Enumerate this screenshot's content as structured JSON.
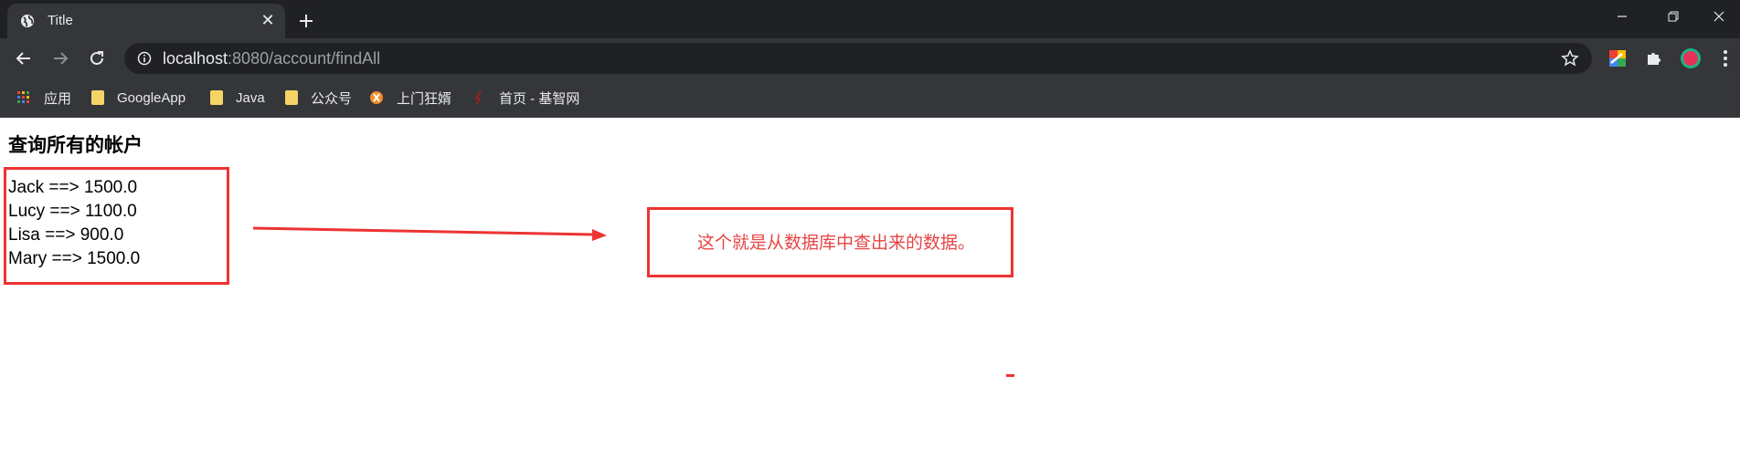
{
  "browser": {
    "tab_title": "Title",
    "url_host": "localhost",
    "url_rest": ":8080/account/findAll",
    "bookmarks": [
      "应用",
      "GoogleApp",
      "Java",
      "公众号",
      "上门狂婿",
      "首页 - 基智网"
    ]
  },
  "page": {
    "heading": "查询所有的帐户",
    "accounts": [
      {
        "name": "Jack",
        "balance": "1500.0"
      },
      {
        "name": "Lucy",
        "balance": "1100.0"
      },
      {
        "name": "Lisa",
        "balance": "900.0"
      },
      {
        "name": "Mary",
        "balance": "1500.0"
      }
    ],
    "annotation": "这个就是从数据库中查出来的数据。"
  },
  "colors": {
    "annotation_red": "#ee3333",
    "chrome_dark": "#202124",
    "toolbar": "#35363a"
  },
  "icons": [
    "globe-icon",
    "close-icon",
    "plus-icon",
    "minimize-icon",
    "restore-icon",
    "window-close-icon",
    "back-icon",
    "forward-icon",
    "reload-icon",
    "info-icon",
    "star-icon",
    "extension-icon",
    "puzzle-icon",
    "profile-icon",
    "menu-icon",
    "apps-icon",
    "folder-icon"
  ]
}
